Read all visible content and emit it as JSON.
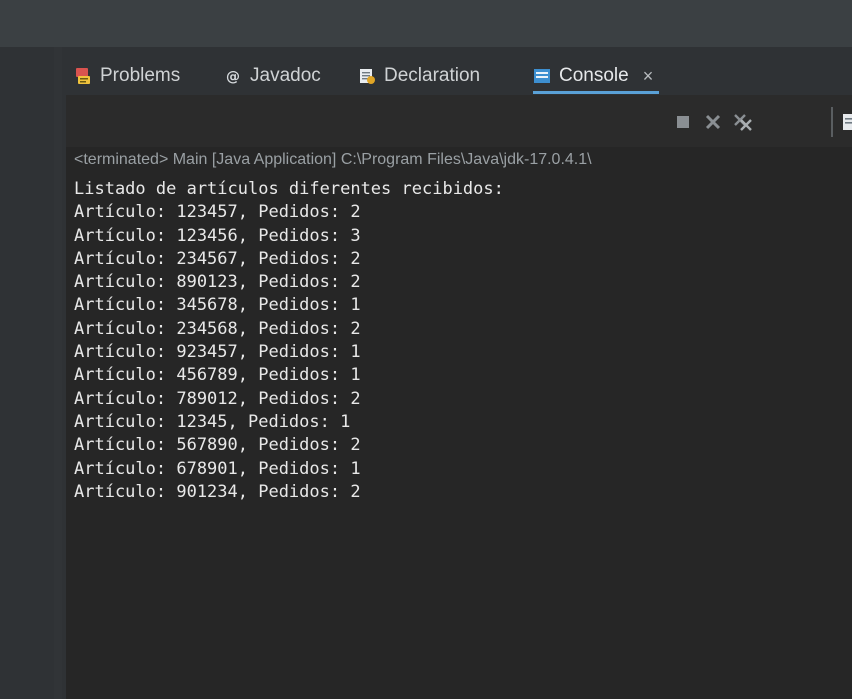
{
  "tabs": [
    {
      "label": "Problems",
      "icon": "problems-icon"
    },
    {
      "label": "Javadoc",
      "icon": "javadoc-icon"
    },
    {
      "label": "Declaration",
      "icon": "declaration-icon"
    },
    {
      "label": "Console",
      "icon": "console-icon",
      "active": true,
      "close": "×"
    }
  ],
  "toolbar": {
    "buttons": [
      "terminate-icon",
      "remove-launch-icon",
      "remove-all-terminated-icon",
      "show-console-icon"
    ]
  },
  "console": {
    "status": "<terminated> Main [Java Application] C:\\Program Files\\Java\\jdk-17.0.4.1\\",
    "lines": [
      "Listado de artículos diferentes recibidos:",
      "Artículo: 123457, Pedidos: 2",
      "Artículo: 123456, Pedidos: 3",
      "Artículo: 234567, Pedidos: 2",
      "Artículo: 890123, Pedidos: 2",
      "Artículo: 345678, Pedidos: 1",
      "Artículo: 234568, Pedidos: 2",
      "Artículo: 923457, Pedidos: 1",
      "Artículo: 456789, Pedidos: 1",
      "Artículo: 789012, Pedidos: 2",
      "Artículo: 12345, Pedidos: 1",
      "Artículo: 567890, Pedidos: 2",
      "Artículo: 678901, Pedidos: 1",
      "Artículo: 901234, Pedidos: 2"
    ]
  },
  "colors": {
    "accent": "#5aa1d7",
    "console_background": "#262626",
    "console_text": "#e8e8e8",
    "status_text": "#9aa0a4"
  }
}
